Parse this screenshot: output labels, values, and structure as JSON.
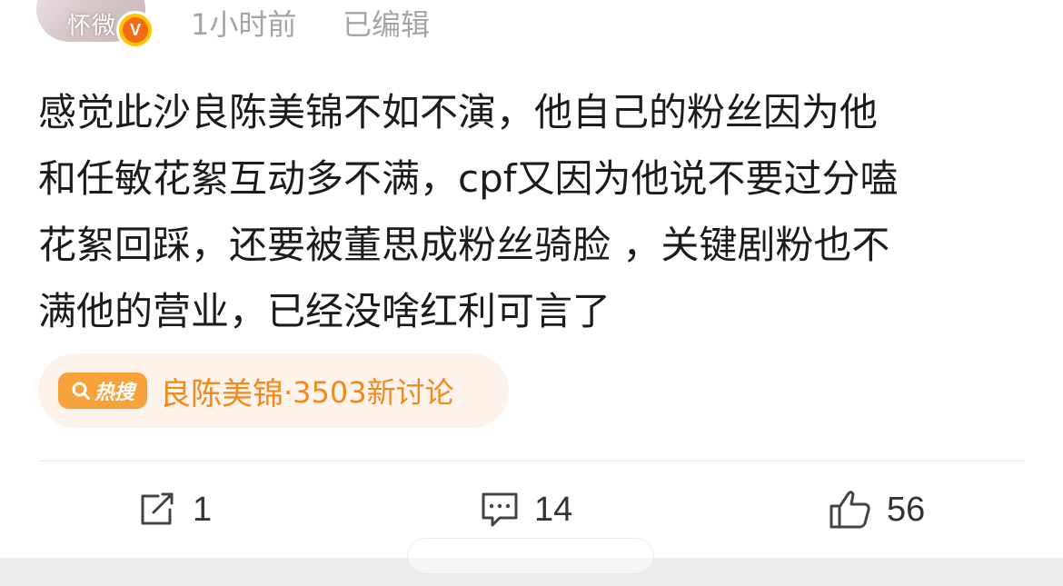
{
  "header": {
    "avatar_text": "怀微",
    "verified_mark": "V",
    "time": "1小时前",
    "edited": "已编辑"
  },
  "post": {
    "lines": [
      "感觉此沙良陈美锦不如不演，他自己的粉丝因为他",
      "和任敏花絮互动多不满，cpf又因为他说不要过分嗑",
      "花絮回踩，还要被董思成粉丝骑脸 ，关键剧粉也不",
      "满他的营业，已经没啥红利可言了"
    ]
  },
  "hot_topic": {
    "badge": "热搜",
    "badge_icon": "search-icon",
    "topic": "良陈美锦",
    "count": "·3503新讨论"
  },
  "actions": {
    "repost": {
      "icon": "repost-icon",
      "count": "1"
    },
    "comment": {
      "icon": "comment-icon",
      "count": "14"
    },
    "like": {
      "icon": "thumbs-up-icon",
      "count": "56"
    }
  },
  "colors": {
    "accent": "#f08a1c",
    "badge": "#f7a23b",
    "pill_bg": "#fdf3ea",
    "verified": "#ffc400",
    "muted_text": "#a5a5a5"
  }
}
